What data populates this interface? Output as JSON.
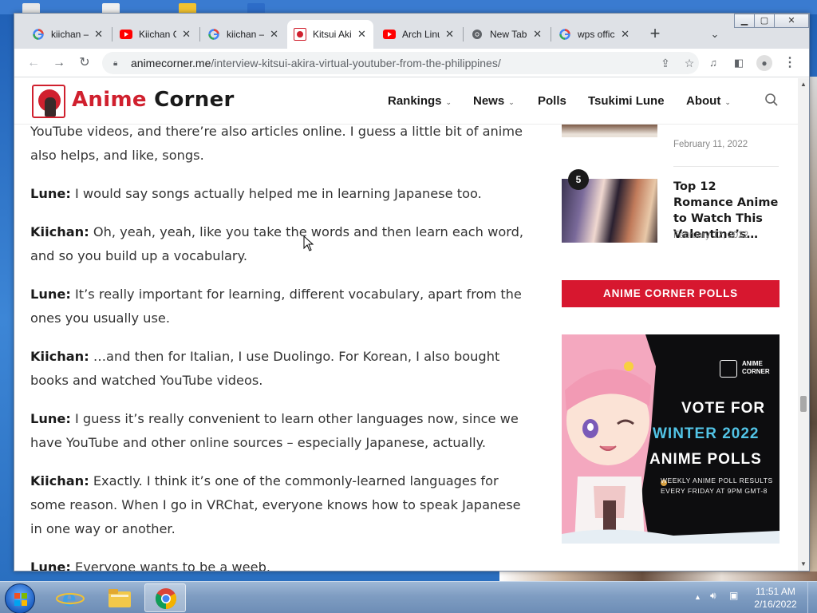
{
  "browser": {
    "tabs": [
      {
        "title": "kiichan – Google Search",
        "favicon": "google-g-icon",
        "active": false
      },
      {
        "title": "Kiichan Ch. – YouTube",
        "favicon": "youtube-icon",
        "active": false
      },
      {
        "title": "kiichan – Google Search",
        "favicon": "google-g-icon",
        "active": false
      },
      {
        "title": "Kitsui Akira",
        "favicon": "anime-corner-icon",
        "active": true
      },
      {
        "title": "Arch Linux – YouTube",
        "favicon": "youtube-icon",
        "active": false
      },
      {
        "title": "New Tab",
        "favicon": "chrome-icon",
        "active": false
      },
      {
        "title": "wps office – Google Search",
        "favicon": "google-g-icon",
        "active": false
      }
    ],
    "new_tab_label": "+",
    "url_domain": "animecorner.me",
    "url_path": "/interview-kitsui-akira-virtual-youtuber-from-the-philippines/"
  },
  "site": {
    "logo_anime": "Anime",
    "logo_corner": " Corner",
    "nav": [
      {
        "label": "Rankings",
        "dropdown": true
      },
      {
        "label": "News",
        "dropdown": true
      },
      {
        "label": "Polls",
        "dropdown": false
      },
      {
        "label": "Tsukimi Lune",
        "dropdown": false
      },
      {
        "label": "About",
        "dropdown": true
      }
    ]
  },
  "article": {
    "paragraphs": [
      {
        "speaker": "",
        "text": "YouTube videos, and there’re also articles online. I guess a little bit of anime also helps, and like, songs."
      },
      {
        "speaker": "Lune:",
        "text": " I would say songs actually helped me in learning Japanese too."
      },
      {
        "speaker": "Kiichan:",
        "text": " Oh, yeah, yeah, like you take the words and then learn each word, and so you build up a vocabulary."
      },
      {
        "speaker": "Lune:",
        "text": " It’s really important for learning, different vocabulary, apart from the ones you usually use."
      },
      {
        "speaker": "Kiichan:",
        "text": " …and then for Italian, I use Duolingo. For Korean, I also bought books and watched YouTube videos."
      },
      {
        "speaker": "Lune:",
        "text": " I guess it’s really convenient to learn other languages now, since we have YouTube and other online sources – especially Japanese, actually."
      },
      {
        "speaker": "Kiichan:",
        "text": " Exactly. I think it’s one of the commonly-learned languages for some reason. When I go in VRChat, everyone knows how to speak Japanese in one way or another."
      },
      {
        "speaker": "Lune:",
        "text": " Everyone wants to be a weeb."
      }
    ]
  },
  "sidebar": {
    "items": [
      {
        "rank": "",
        "title": "",
        "date": "February 11, 2022"
      },
      {
        "rank": "5",
        "title": "Top 12 Romance Anime to Watch This Valentine’s…",
        "date": "February 12, 2022"
      }
    ],
    "polls_button": "ANIME CORNER POLLS",
    "banner": {
      "brand": "ANIME CORNER",
      "line1": "VOTE FOR",
      "line2": "WINTER 2022",
      "line3": "ANIME POLLS",
      "sub1": "WEEKLY ANIME POLL RESULTS",
      "sub2": "EVERY FRIDAY AT 9PM GMT-8"
    }
  },
  "taskbar": {
    "time": "11:51 AM",
    "date": "2/16/2022"
  },
  "colors": {
    "brand_red": "#d7172f",
    "banner_blue": "#52c4e6"
  }
}
